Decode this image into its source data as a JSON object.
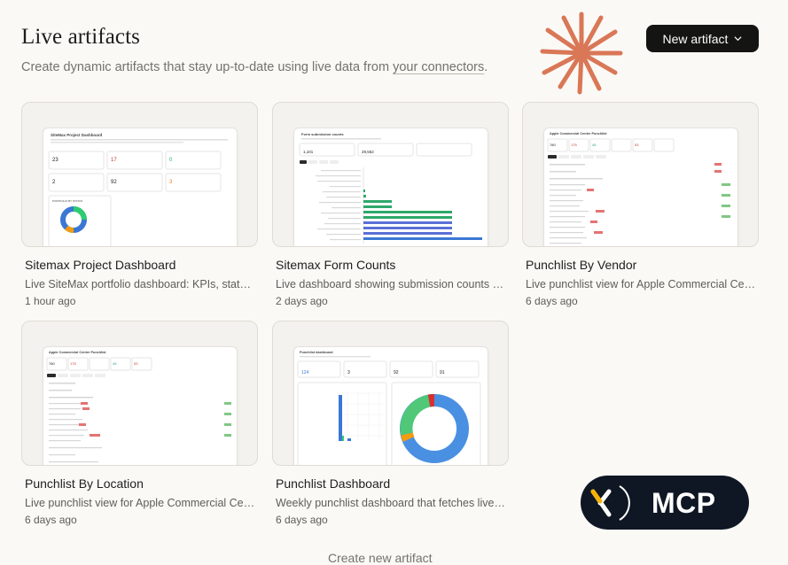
{
  "header": {
    "title": "Live artifacts",
    "subtitle_prefix": "Create dynamic artifacts that stay up-to-date using live data from ",
    "subtitle_link": "your connectors",
    "subtitle_suffix": "."
  },
  "new_artifact_button": {
    "label": "New artifact"
  },
  "accent_color": "#d97757",
  "artifacts": [
    {
      "title": "Sitemax Project Dashboard",
      "description": "Live SiteMax portfolio dashboard: KPIs, status breakdown and project list",
      "time": "1 hour ago"
    },
    {
      "title": "Sitemax Form Counts",
      "description": "Live dashboard showing submission counts by form type",
      "time": "2 days ago"
    },
    {
      "title": "Punchlist By Vendor",
      "description": "Live punchlist view for Apple Commercial Center grouped by vendor",
      "time": "6 days ago"
    },
    {
      "title": "Punchlist By Location",
      "description": "Live punchlist view for Apple Commercial Center grouped by location",
      "time": "6 days ago"
    },
    {
      "title": "Punchlist Dashboard",
      "description": "Weekly punchlist dashboard that fetches live data",
      "time": "6 days ago"
    }
  ],
  "thumb_text": {
    "project_dashboard": "SiteMax Project Dashboard",
    "kpi_values": [
      "23",
      "17",
      "0",
      "2",
      "92",
      "3"
    ],
    "portfolio_label": "PORTFOLIO BY STATUS",
    "form_counts_title": "Form submission counts",
    "form_counts_kpis": [
      "1,101",
      "29,552"
    ],
    "punchlist_title": "Apple Commercial Center Punchlist",
    "punch_kpis": [
      "780",
      "175",
      "45",
      "53"
    ],
    "dashboard_title": "Punchlist dashboard",
    "dashboard_kpis": [
      "124",
      "3",
      "92",
      "91"
    ]
  },
  "badge": {
    "text": "MCP"
  },
  "footer": {
    "text": "Create new artifact"
  }
}
